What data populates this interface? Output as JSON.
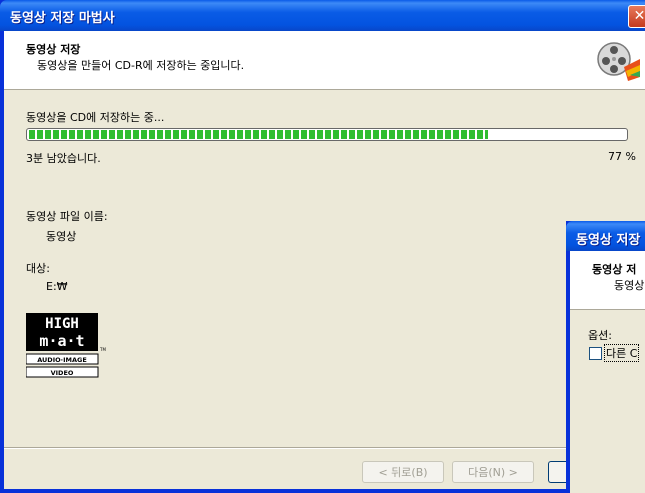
{
  "window": {
    "title": "동영상 저장 마법사",
    "close_glyph": "✕"
  },
  "header": {
    "title": "동영상 저장",
    "subtitle": "동영상을 만들어 CD-R에 저장하는 중입니다.",
    "icon": "film-reel-icon"
  },
  "progress": {
    "status": "동영상을 CD에 저장하는 중...",
    "value": 0.77,
    "time_left": "3분 남았습니다.",
    "percent_text": "77 %"
  },
  "file": {
    "name_label": "동영상 파일 이름:",
    "name_value": "동영상"
  },
  "target": {
    "label": "대상:",
    "value": "E:₩"
  },
  "logo": {
    "line1": "HIGH",
    "line2": "m·a·t",
    "line3": "AUDIO·IMAGE",
    "line4": "VIDEO",
    "tm": "TM"
  },
  "buttons": {
    "back": "< 뒤로(B)",
    "next": "다음(N) >"
  },
  "second_window": {
    "title": "동영상 저장",
    "header_title": "동영상 저",
    "header_sub": "동영상",
    "options_label": "옵션:",
    "checkbox_label": "다른 C"
  },
  "colors": {
    "titlebar": "#0a5ce6",
    "progress": "#2fbd2f",
    "dialog_bg": "#ece9d8"
  }
}
